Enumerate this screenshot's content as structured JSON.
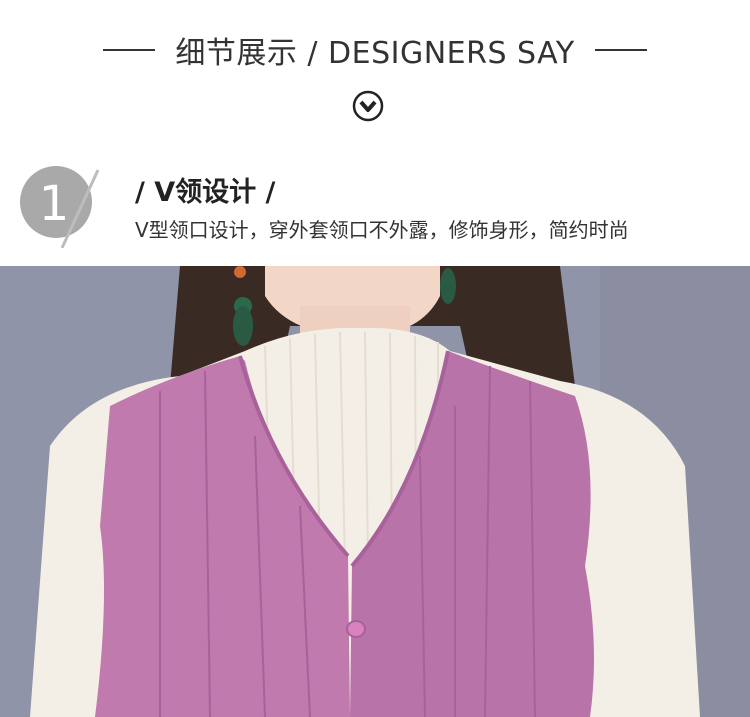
{
  "header": {
    "title": "细节展示 / DESIGNERS SAY",
    "icon": "chevron-down-circle-icon"
  },
  "feature": {
    "number": "1",
    "title": "/ V领设计 /",
    "description": "V型领口设计，穿外套领口不外露，修饰身形，简约时尚"
  },
  "photo": {
    "subject": "product-photo-vest",
    "colors": {
      "vest": "#c07aae",
      "sweater": "#f4efe6",
      "background": "#8f93a6",
      "hair": "#3a2a24"
    }
  }
}
